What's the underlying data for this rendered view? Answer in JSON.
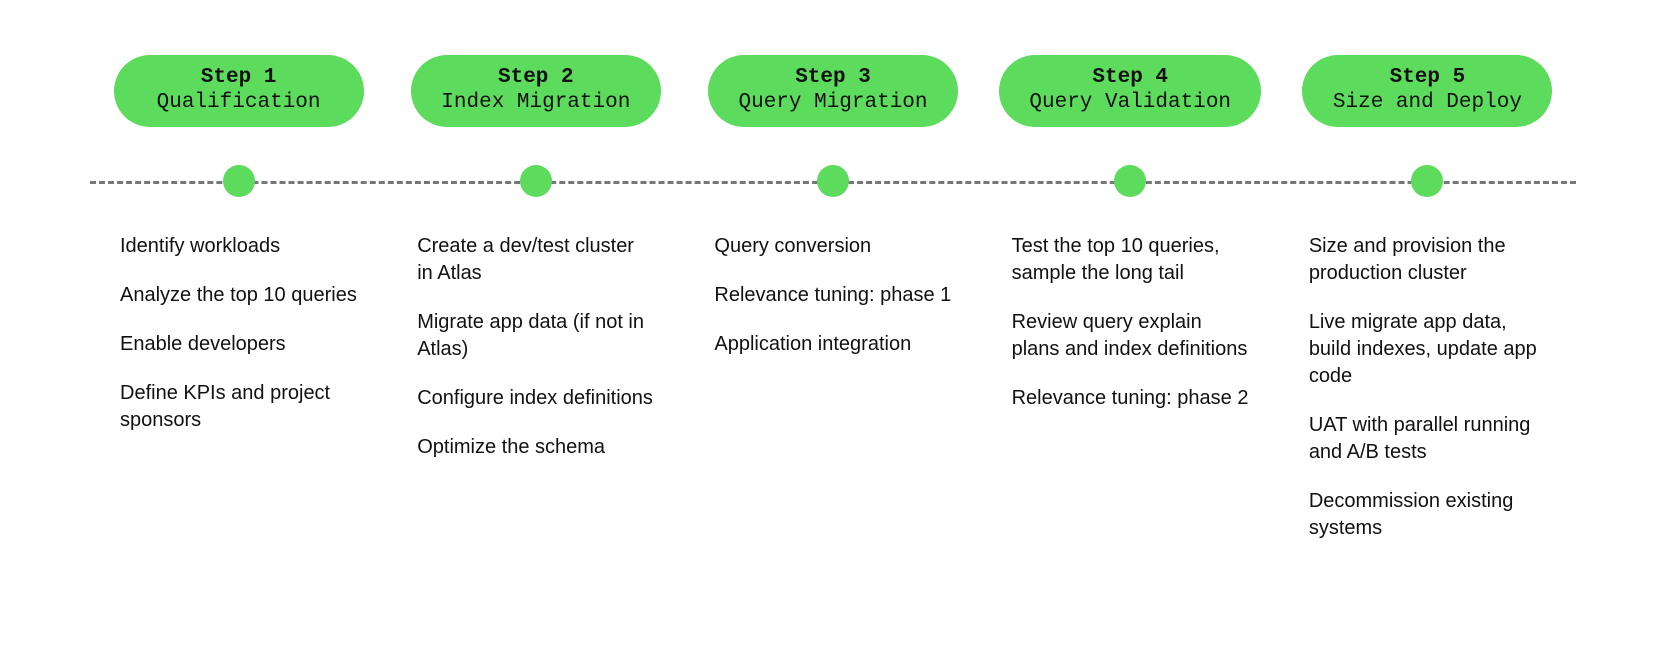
{
  "steps": [
    {
      "number": "Step 1",
      "title": "Qualification",
      "details": [
        "Identify workloads",
        "Analyze the top 10 queries",
        "Enable developers",
        "Define KPIs and project sponsors"
      ]
    },
    {
      "number": "Step 2",
      "title": "Index Migration",
      "details": [
        "Create a dev/test cluster in Atlas",
        "Migrate app data (if not in Atlas)",
        "Configure index definitions",
        "Optimize the schema"
      ]
    },
    {
      "number": "Step 3",
      "title": "Query Migration",
      "details": [
        "Query conversion",
        "Relevance tuning: phase 1",
        "Application integration"
      ]
    },
    {
      "number": "Step 4",
      "title": "Query Validation",
      "details": [
        "Test the top 10 queries, sample the long tail",
        "Review query explain plans and index definitions",
        "Relevance tuning: phase 2"
      ]
    },
    {
      "number": "Step 5",
      "title": "Size and Deploy",
      "details": [
        "Size and provision the production cluster",
        "Live migrate app data, build indexes, update app code",
        "UAT with parallel running and A/B tests",
        "Decommission existing systems"
      ]
    }
  ]
}
